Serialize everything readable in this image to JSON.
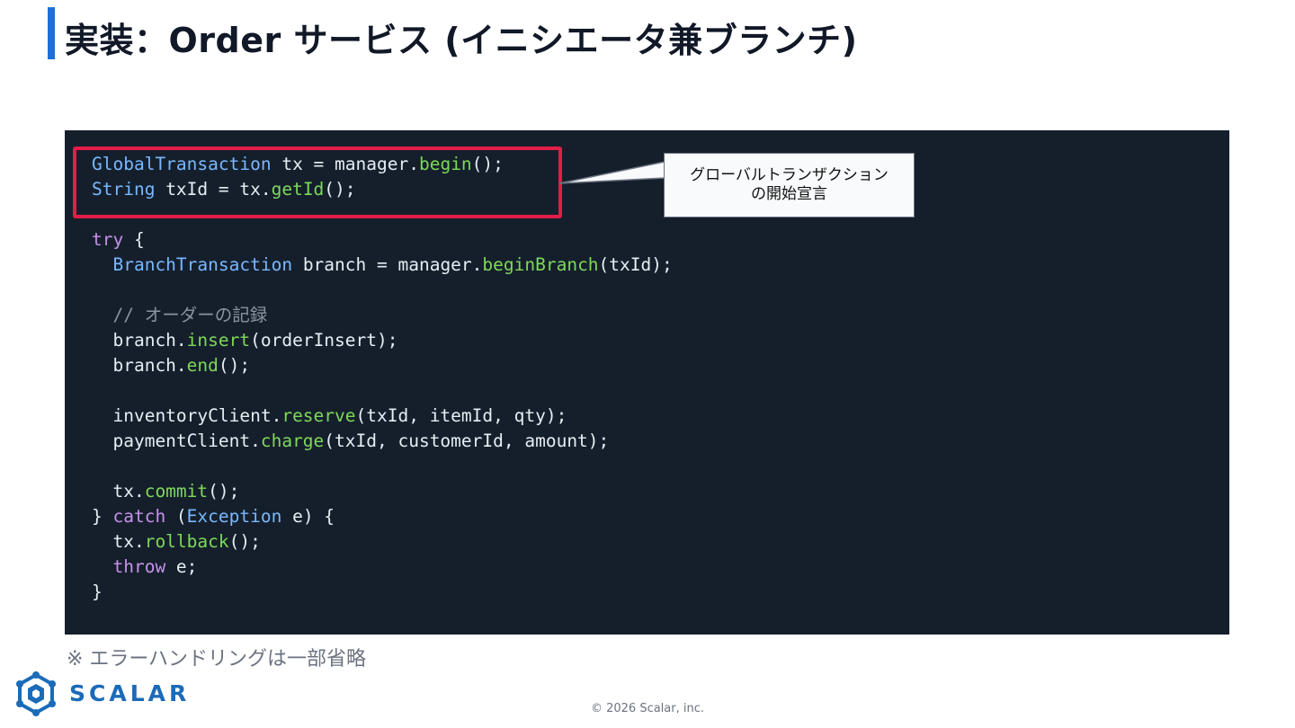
{
  "slide": {
    "title": "実装：Order サービス (イニシエータ兼ブランチ)",
    "note": "※ エラーハンドリングは一部省略",
    "footer": "© 2026 Scalar, inc."
  },
  "brand": {
    "name": "SCALAR",
    "logo_icon": "scalar-logo-icon",
    "accent_color": "#1e6fd9",
    "highlight_color": "#e11d48"
  },
  "callout": {
    "line1": "グローバルトランザクション",
    "line2": "の開始宣言"
  },
  "code": {
    "l1": {
      "type": "GlobalTransaction",
      "a": " tx = manager.",
      "fn": "begin",
      "b": "();"
    },
    "l2": {
      "type": "String",
      "a": " txId = tx.",
      "fn": "getId",
      "b": "();"
    },
    "l4": {
      "kw": "try",
      "a": " {"
    },
    "l5": {
      "indent": "  ",
      "type": "BranchTransaction",
      "a": " branch = manager.",
      "fn": "beginBranch",
      "b": "(txId);"
    },
    "l7": {
      "indent": "  ",
      "comment": "// オーダーの記録"
    },
    "l8": {
      "a": "  branch.",
      "fn": "insert",
      "b": "(orderInsert);"
    },
    "l9": {
      "a": "  branch.",
      "fn": "end",
      "b": "();"
    },
    "l11": {
      "a": "  inventoryClient.",
      "fn": "reserve",
      "b": "(txId, itemId, qty);"
    },
    "l12": {
      "a": "  paymentClient.",
      "fn": "charge",
      "b": "(txId, customerId, amount);"
    },
    "l14": {
      "a": "  tx.",
      "fn": "commit",
      "b": "();"
    },
    "l15": {
      "a": "} ",
      "kw": "catch",
      "b": " (",
      "type": "Exception",
      "c": " e) {"
    },
    "l16": {
      "a": "  tx.",
      "fn": "rollback",
      "b": "();"
    },
    "l17": {
      "indent": "  ",
      "kw": "throw",
      "a": " e;"
    },
    "l18": {
      "a": "}"
    }
  }
}
